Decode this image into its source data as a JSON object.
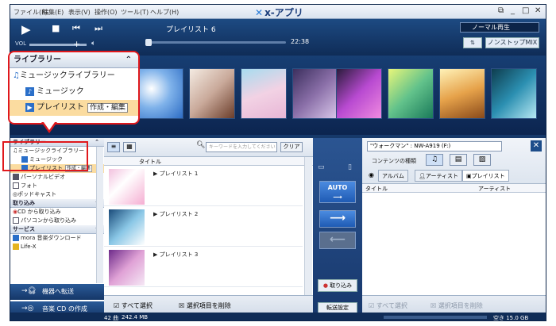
{
  "app": {
    "title": "x-アプリ",
    "logo_glyph": "✕"
  },
  "menu": [
    "ファイル(F)",
    "編集(E)",
    "表示(V)",
    "操作(O)",
    "ツール(T)",
    "ヘルプ(H)"
  ],
  "window_controls": [
    "⧉",
    "_",
    "□",
    "✕"
  ],
  "player": {
    "playlist_title": "プレイリスト 6",
    "time": "22:38",
    "vol_label": "VOL",
    "play_mode": "ノーマル再生",
    "shuffle_label": "⇅",
    "nonstop_label": "ノンストップMIX",
    "seek_position": 0.0
  },
  "callout": {
    "header": "ライブラリー",
    "items": [
      "ミュージックライブラリー",
      "ミュージック",
      "プレイリスト"
    ],
    "edit_label": "作成・編集"
  },
  "library": {
    "header": "ライブラリー",
    "items": [
      "ミュージックライブラリー",
      "ミュージック",
      "プレイリスト",
      "パーソナルビデオ",
      "フォト",
      "ポッドキャスト"
    ],
    "edit_label": "作成・編集",
    "import_header": "取り込み",
    "import_items": [
      "CD から取り込み",
      "パソコンから取り込み"
    ],
    "service_header": "サービス",
    "service_items": [
      "mora 音楽ダウンロード",
      "Life-X"
    ],
    "transfer_button": "機器へ転送",
    "cd_button": "音楽 CD の作成"
  },
  "middle": {
    "search_placeholder": "キーワードを入力してください",
    "clear_label": "クリア",
    "col_title": "タイトル",
    "playlists": [
      "プレイリスト 1",
      "プレイリスト 2",
      "プレイリスト 3"
    ],
    "select_all": "すべて選択",
    "delete_selected": "選択項目を削除"
  },
  "transfer": {
    "auto_label": "AUTO",
    "import_label": "取り込み",
    "settings_label": "転送設定"
  },
  "device": {
    "selected": "\"ウォークマン\" : NW-A919 (F:)",
    "content_type_label": "コンテンツの種類",
    "tabs": [
      "アルバム",
      "アーティスト",
      "プレイリスト"
    ],
    "col_title": "タイトル",
    "col_artist": "アーティスト",
    "select_all": "すべて選択",
    "delete_selected": "選択項目を削除"
  },
  "status": {
    "count": "42 曲",
    "size": "242.4 MB",
    "free": "空き 15.0 GB"
  },
  "colors": {
    "accent": "#e0181c",
    "frame": "#16396a"
  }
}
